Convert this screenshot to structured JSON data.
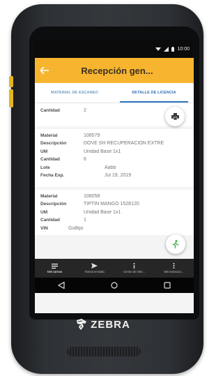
{
  "status_bar": {
    "time": "10:00"
  },
  "app_bar": {
    "title": "Recepción gen..."
  },
  "tabs": [
    {
      "label": "MATERIAL DE ESCANEO",
      "active": false
    },
    {
      "label": "DETALLE DE LICENCIA",
      "active": true
    }
  ],
  "cards": [
    {
      "rows": [
        {
          "label": "Cantidad",
          "value": "2"
        }
      ]
    },
    {
      "rows": [
        {
          "label": "Material",
          "value": "108579"
        },
        {
          "label": "Descripción",
          "value": "DOVE SH RECUPERACION EXTRE"
        },
        {
          "label": "UM",
          "value": "Unidad Base 1x1"
        },
        {
          "label": "Cantidad",
          "value": "6"
        },
        {
          "label": "Lote",
          "value": "Aabb"
        },
        {
          "label": "Fecha Exp.",
          "value": "Jul 19, 2019"
        }
      ]
    },
    {
      "rows": [
        {
          "label": "Material",
          "value": "108058"
        },
        {
          "label": "Descripción",
          "value": "TIPTIN MANGO 1528120"
        },
        {
          "label": "UM",
          "value": "Unidad Base 1x1"
        },
        {
          "label": "Cantidad",
          "value": "1"
        },
        {
          "label": "VIN",
          "value": "Gullkjo"
        }
      ]
    }
  ],
  "bottom_nav": [
    {
      "label": "Mis tareas",
      "icon": "list-icon",
      "active": true
    },
    {
      "label": "Tareas enviada",
      "icon": "send-icon",
      "active": false
    },
    {
      "label": "Centro de infor...",
      "icon": "info-icon",
      "active": false
    },
    {
      "label": "Mis transacci...",
      "icon": "more-icon",
      "active": false
    }
  ],
  "brand": {
    "name": "ZEBRA"
  },
  "colors": {
    "accent": "#f7b52f",
    "tab_active": "#2f78c6",
    "fab_icon": "#4caf50"
  }
}
